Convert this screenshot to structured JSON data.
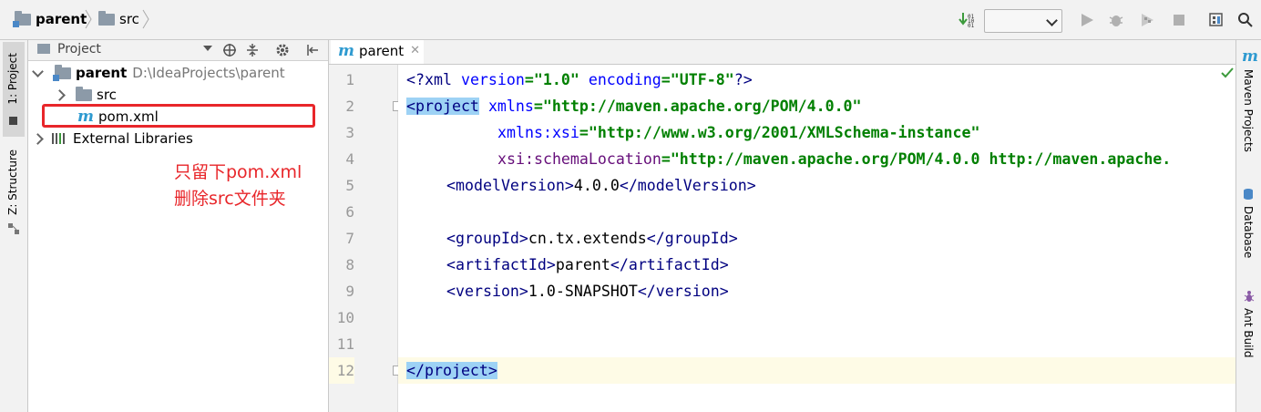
{
  "breadcrumb": {
    "root": "parent",
    "child": "src"
  },
  "project_panel": {
    "title": "Project",
    "tree": [
      {
        "name": "parent",
        "path": "D:\\IdeaProjects\\parent"
      },
      {
        "name": "src"
      },
      {
        "name": "pom.xml"
      },
      {
        "name": "External Libraries"
      }
    ]
  },
  "annotation": {
    "line1": "只留下pom.xml",
    "line2": "删除src文件夹"
  },
  "left_strip": {
    "project_tab": "1: Project",
    "structure_tab": "Z: Structure"
  },
  "right_strip": {
    "maven": "Maven Projects",
    "database": "Database",
    "ant": "Ant Build"
  },
  "editor": {
    "tab_label": "parent",
    "line_numbers": [
      "1",
      "2",
      "3",
      "4",
      "5",
      "6",
      "7",
      "8",
      "9",
      "10",
      "11",
      "12"
    ],
    "code": {
      "l1_a": "<?",
      "l1_b": "xml ",
      "l1_c": "version",
      "l1_d": "=\"1.0\" ",
      "l1_e": "encoding",
      "l1_f": "=\"UTF-8\"",
      "l1_g": "?>",
      "l2_tag": "<project",
      "l2_attr": "xmlns",
      "l2_val": "=\"http://maven.apache.org/POM/4.0.0\"",
      "l3_ns": "xmlns:xsi",
      "l3_val": "=\"http://www.w3.org/2001/XMLSchema-instance\"",
      "l4_ns": "xsi:schemaLocation",
      "l4_val": "=\"http://maven.apache.org/POM/4.0.0 http://maven.apache.",
      "l5_open": "<modelVersion>",
      "l5_text": "4.0.0",
      "l5_close": "</modelVersion>",
      "l7_open": "<groupId>",
      "l7_text": "cn.tx.extends",
      "l7_close": "</groupId>",
      "l8_open": "<artifactId>",
      "l8_text": "parent",
      "l8_close": "</artifactId>",
      "l9_open": "<version>",
      "l9_text": "1.0-SNAPSHOT",
      "l9_close": "</version>",
      "l12_tag": "</project>"
    }
  },
  "colors": {
    "accent": "#2e9ad0",
    "annotation": "#e8262a",
    "highlight": "#9dd2f5"
  }
}
